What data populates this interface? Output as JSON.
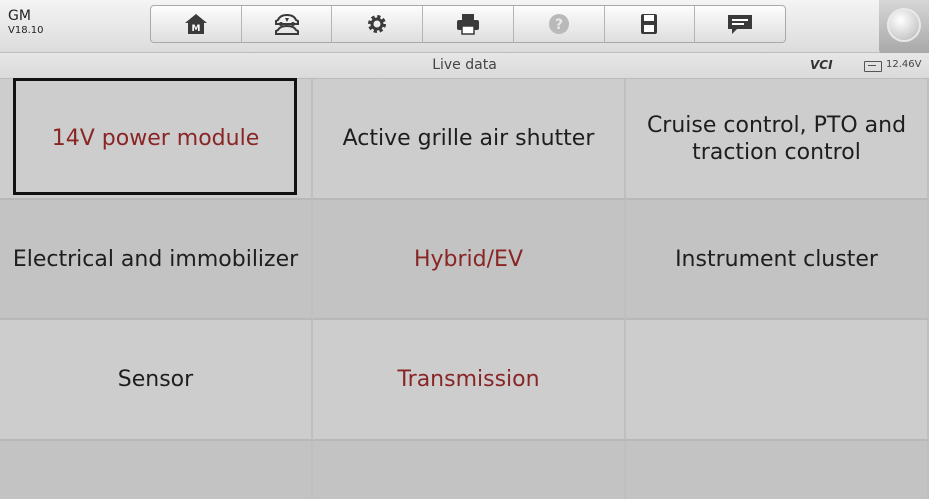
{
  "app": {
    "make": "GM",
    "version": "V18.10"
  },
  "toolbar": {
    "buttons": [
      {
        "name": "home-icon"
      },
      {
        "name": "vehicle-swap-icon"
      },
      {
        "name": "settings-icon"
      },
      {
        "name": "print-icon"
      },
      {
        "name": "help-icon"
      },
      {
        "name": "save-icon"
      },
      {
        "name": "message-icon"
      }
    ]
  },
  "status": {
    "title": "Live data",
    "vci_label": "VCI",
    "battery_voltage": "12.46V"
  },
  "menu": {
    "items": [
      {
        "label": "14V power module",
        "highlight": true,
        "selected": true
      },
      {
        "label": "Active grille air shutter",
        "highlight": false
      },
      {
        "label": "Cruise control, PTO and traction control",
        "highlight": false
      },
      {
        "label": "Electrical and immobilizer",
        "highlight": false
      },
      {
        "label": "Hybrid/EV",
        "highlight": true
      },
      {
        "label": "Instrument cluster",
        "highlight": false
      },
      {
        "label": "Sensor",
        "highlight": false
      },
      {
        "label": "Transmission",
        "highlight": true
      }
    ]
  },
  "colors": {
    "highlight_text": "#8a2525",
    "normal_text": "#1e1e1e",
    "vci_accent": "#2a9a2a"
  }
}
